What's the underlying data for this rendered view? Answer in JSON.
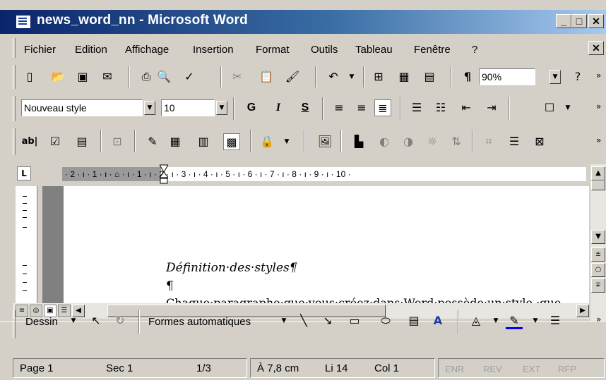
{
  "window": {
    "title": "news_word_nn - Microsoft Word"
  },
  "caption_buttons": {
    "minimize": "_",
    "maximize": "□",
    "close": "✕"
  },
  "menu": {
    "items": [
      "Fichier",
      "Edition",
      "Affichage",
      "Insertion",
      "Format",
      "Outils",
      "Tableau",
      "Fenêtre",
      "?"
    ],
    "close": "✕"
  },
  "standard_toolbar": {
    "zoom": "90%"
  },
  "formatting_toolbar": {
    "style": "Nouveau style",
    "font_size": "10",
    "bold": "G",
    "italic": "I",
    "underline": "S"
  },
  "ruler": {
    "tab_selector": "L",
    "labels": "· 2 · ı · 1 · ı · ⌂ · ı · 1 · ı · 2 · ı · 3 · ı · 4 · ı · 5 · ı · 6 · ı · 7 · ı · 8 · ı · 9 · ı · 10 ·"
  },
  "document": {
    "heading": "Définition·des·styles¶",
    "empty_paragraph": "¶",
    "body_start": "Chaque·paragraphe·que·vous·créez·dans·Word·possède·un·style,·que"
  },
  "drawing_toolbar": {
    "draw": "Dessin",
    "autoshapes": "Formes automatiques"
  },
  "status": {
    "page": "Page 1",
    "section": "Sec 1",
    "pages": "1/3",
    "position": "À 7,8 cm",
    "line": "Li 14",
    "column": "Col 1",
    "modes": [
      "ENR",
      "REV",
      "EXT",
      "RFP"
    ]
  }
}
